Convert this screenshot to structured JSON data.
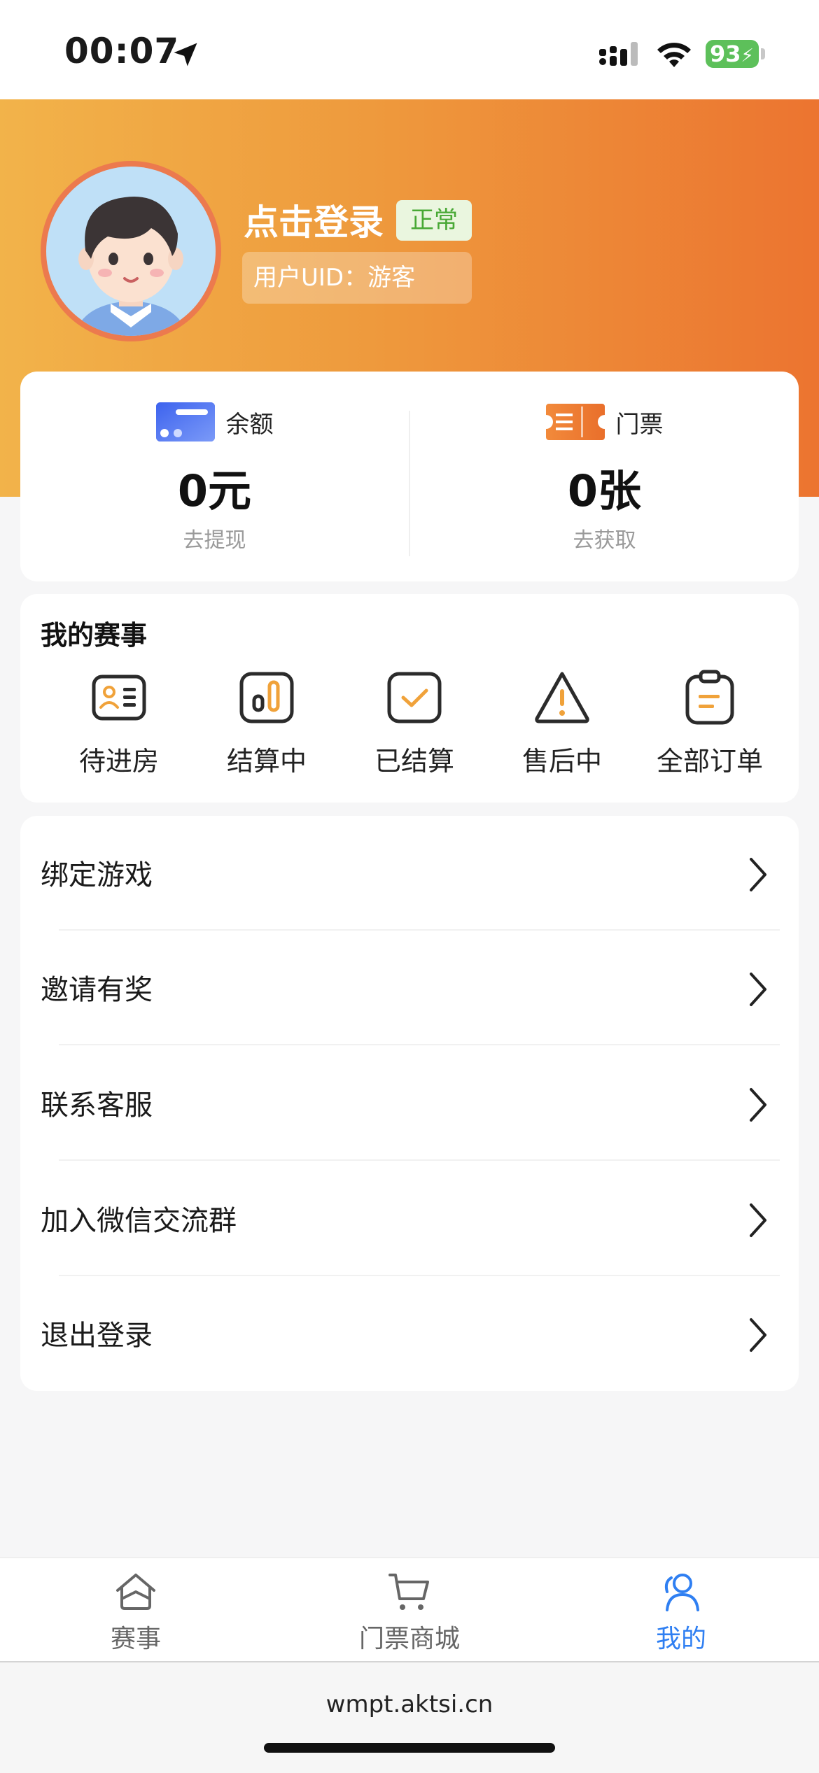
{
  "status_bar": {
    "time": "00:07",
    "battery": "93"
  },
  "profile": {
    "login_label": "点击登录",
    "status_badge": "正常",
    "uid_text": "用户UID：游客"
  },
  "stats": {
    "balance": {
      "label": "余额",
      "value": "0元",
      "action": "去提现"
    },
    "tickets": {
      "label": "门票",
      "value": "0张",
      "action": "去获取"
    }
  },
  "my_events": {
    "title": "我的赛事",
    "items": [
      {
        "label": "待进房",
        "icon": "id-card-icon"
      },
      {
        "label": "结算中",
        "icon": "progress-icon"
      },
      {
        "label": "已结算",
        "icon": "check-box-icon"
      },
      {
        "label": "售后中",
        "icon": "warning-icon"
      },
      {
        "label": "全部订单",
        "icon": "clipboard-icon"
      }
    ]
  },
  "menu": {
    "items": [
      {
        "label": "绑定游戏"
      },
      {
        "label": "邀请有奖"
      },
      {
        "label": "联系客服"
      },
      {
        "label": "加入微信交流群"
      },
      {
        "label": "退出登录"
      }
    ]
  },
  "tabbar": {
    "tabs": [
      {
        "label": "赛事",
        "icon": "home-icon",
        "active": false
      },
      {
        "label": "门票商城",
        "icon": "cart-icon",
        "active": false
      },
      {
        "label": "我的",
        "icon": "user-icon",
        "active": true
      }
    ]
  },
  "browser": {
    "url": "wmpt.aktsi.cn"
  },
  "colors": {
    "accent_orange": "#ee9a3d",
    "event_icon_orange": "#f0a23a",
    "active_tab_blue": "#2f7ff2",
    "badge_green": "#48a834"
  }
}
